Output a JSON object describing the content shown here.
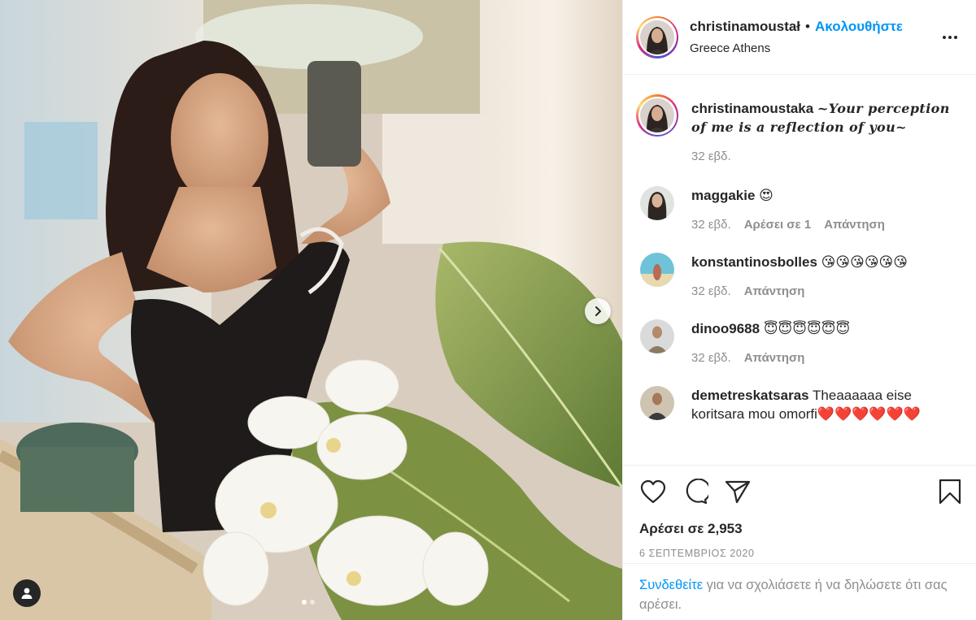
{
  "post": {
    "username": "christinamoustaka",
    "username_display": "christinamoustał",
    "separator": "•",
    "follow_label": "Ακολουθήστε",
    "location": "Greece Athens"
  },
  "caption": {
    "username": "christinamoustaka",
    "text": "~Your perception of me is a reflection of you~",
    "age": "32 εβδ."
  },
  "comments": [
    {
      "username": "maggakie",
      "text": "😍",
      "age": "32 εβδ.",
      "likes": "Αρέσει σε 1",
      "reply": "Απάντηση"
    },
    {
      "username": "konstantinosbolles",
      "text": "😘😘😘😘😘😘",
      "age": "32 εβδ.",
      "reply": "Απάντηση"
    },
    {
      "username": "dinoo9688",
      "text": "😇😇😇😇😇😇",
      "age": "32 εβδ.",
      "reply": "Απάντηση"
    },
    {
      "username": "demetreskatsaras",
      "text": "Theaaaaaa eise koritsara mou omorfi❤️❤️❤️❤️❤️❤️"
    }
  ],
  "actions": {
    "likes_label": "Αρέσει σε 2,953",
    "date": "6 ΣΕΠΤΕΜΒΡΙΟΣ 2020"
  },
  "login_prompt": {
    "link": "Συνδεθείτε",
    "text": " για να σχολιάσετε ή να δηλώσετε ότι σας αρέσει."
  },
  "carousel": {
    "current_index": 1,
    "total": 2
  },
  "colors": {
    "link": "#0095f6",
    "text": "#262626",
    "muted": "#8e8e8e"
  },
  "icons": [
    "chevron-right-icon",
    "user-tag-icon",
    "more-options-icon",
    "heart-icon",
    "comment-icon",
    "share-icon",
    "bookmark-icon"
  ]
}
